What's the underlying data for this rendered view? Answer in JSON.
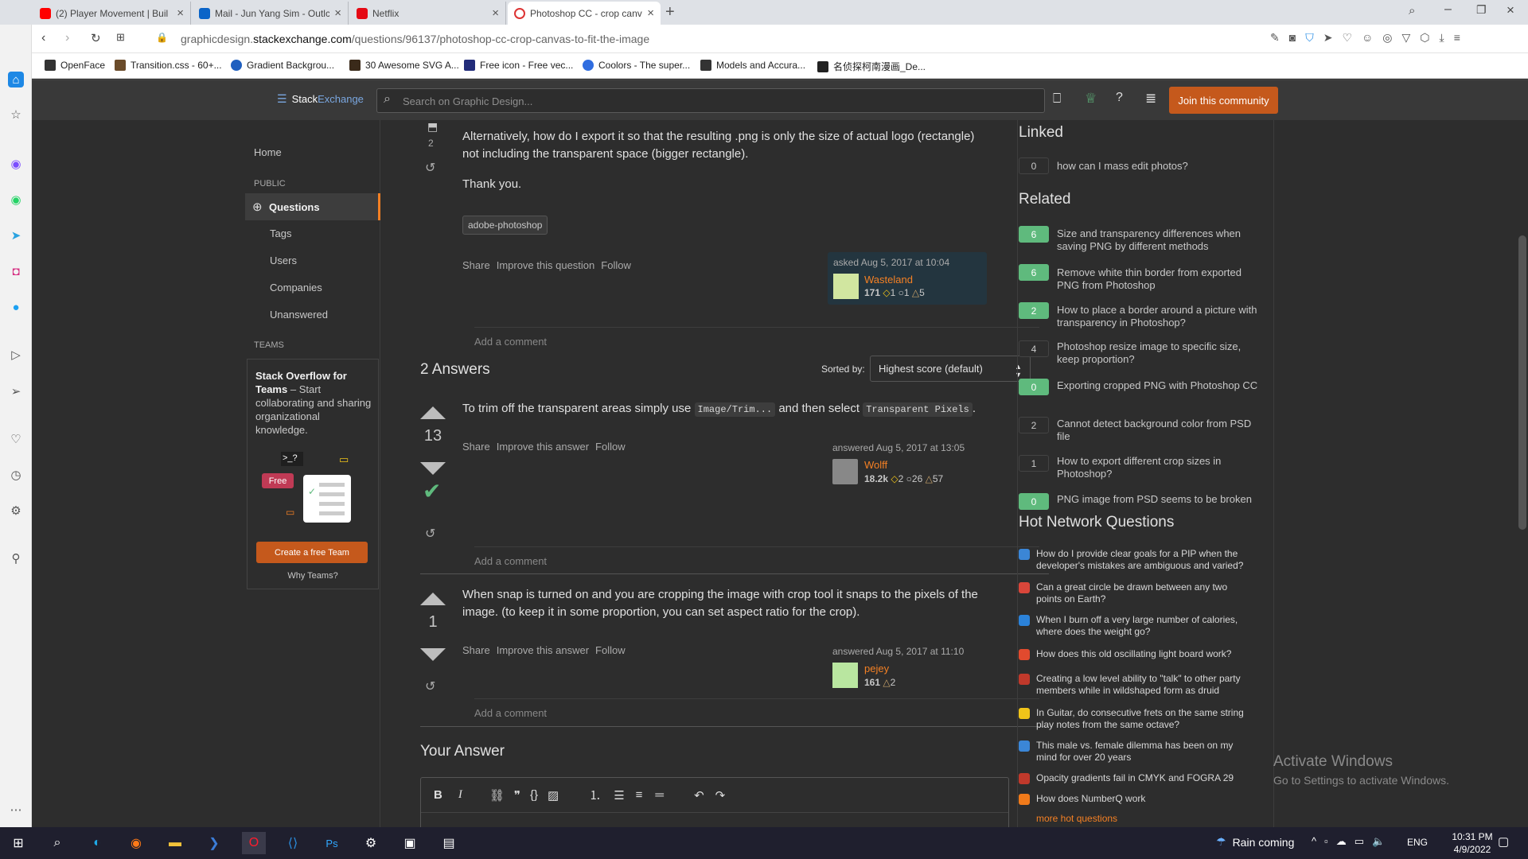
{
  "browser": {
    "tabs": [
      {
        "label": "(2) Player Movement | Buil",
        "color": "#ff0000"
      },
      {
        "label": "Mail - Jun Yang Sim - Outlc",
        "color": "#0a64c8"
      },
      {
        "label": "Netflix",
        "color": "#e50914"
      },
      {
        "label": "Photoshop CC - crop canva",
        "color": "#e0e0e0"
      }
    ],
    "url_prefix": "graphicdesign.",
    "url_domain": "stackexchange.com",
    "url_path": "/questions/96137/photoshop-cc-crop-canvas-to-fit-the-image",
    "bookmarks": [
      {
        "label": "OpenFace",
        "color": "#333"
      },
      {
        "label": "Transition.css - 60+...",
        "color": "#6a4b2a"
      },
      {
        "label": "Gradient Backgrou...",
        "color": "#1f5fbf"
      },
      {
        "label": "30 Awesome SVG A...",
        "color": "#3a2a1a"
      },
      {
        "label": "Free icon - Free vec...",
        "color": "#222c7a"
      },
      {
        "label": "Coolors - The super...",
        "color": "#2f6de0"
      },
      {
        "label": "Models and Accura...",
        "color": "#333"
      },
      {
        "label": "名侦探柯南漫画_De...",
        "color": "#222"
      }
    ]
  },
  "header": {
    "logo_a": "Stack",
    "logo_b": "Exchange",
    "search_placeholder": "Search on Graphic Design...",
    "join": "Join this community"
  },
  "leftnav": {
    "home": "Home",
    "public": "PUBLIC",
    "questions": "Questions",
    "tags": "Tags",
    "users": "Users",
    "companies": "Companies",
    "unanswered": "Unanswered",
    "teams": "TEAMS",
    "teams_title": "Stack Overflow for Teams",
    "teams_desc": " – Start collaborating and sharing organizational knowledge.",
    "free": "Free",
    "prompt": ">_?",
    "create": "Create a free Team",
    "why": "Why Teams?"
  },
  "question": {
    "bookmarks": "2",
    "para1": "Alternatively, how do I export it so that the resulting .png is only the size of actual logo (rectangle) not including the transparent space (bigger rectangle).",
    "para2": "Thank you.",
    "tag": "adobe-photoshop",
    "share": "Share",
    "improve": "Improve this question",
    "follow": "Follow",
    "asked": "asked Aug 5, 2017 at 10:04",
    "user": "Wasteland",
    "rep": "171",
    "gold": "1",
    "silver": "1",
    "bronze": "5",
    "comment": "Add a comment"
  },
  "answers": {
    "count": "2 Answers",
    "sorted": "Sorted by:",
    "sort_value": "Highest score (default)",
    "a1": {
      "score": "13",
      "pre": "To trim off the transparent areas simply use ",
      "code1": "Image/Trim...",
      "mid": " and then select ",
      "code2": "Transparent Pixels",
      "post": ".",
      "share": "Share",
      "improve": "Improve this answer",
      "follow": "Follow",
      "answered": "answered Aug 5, 2017 at 13:05",
      "user": "Wolff",
      "rep": "18.2k",
      "gold": "2",
      "silver": "26",
      "bronze": "57",
      "comment": "Add a comment"
    },
    "a2": {
      "score": "1",
      "text": "When snap is turned on and you are cropping the image with crop tool it snaps to the pixels of the image. (to keep it in some proportion, you can set aspect ratio for the crop).",
      "share": "Share",
      "improve": "Improve this answer",
      "follow": "Follow",
      "answered": "answered Aug 5, 2017 at 11:10",
      "user": "pejey",
      "rep": "161",
      "bronze": "2",
      "comment": "Add a comment"
    },
    "your_answer": "Your Answer"
  },
  "sidebar": {
    "linked_title": "Linked",
    "linked": [
      {
        "score": "0",
        "text": "how can I mass edit photos?"
      }
    ],
    "related_title": "Related",
    "related": [
      {
        "score": "6",
        "text": "Size and transparency differences when saving PNG by different methods"
      },
      {
        "score": "6",
        "text": "Remove white thin border from exported PNG from Photoshop"
      },
      {
        "score": "2",
        "text": "How to place a border around a picture with transparency in Photoshop?"
      },
      {
        "score": "4",
        "text": "Photoshop resize image to specific size, keep proportion?"
      },
      {
        "score": "0",
        "text": "Exporting cropped PNG with Photoshop CC"
      },
      {
        "score": "2",
        "text": "Cannot detect background color from PSD file"
      },
      {
        "score": "1",
        "text": "How to export different crop sizes in Photoshop?"
      },
      {
        "score": "0",
        "text": "PNG image from PSD seems to be broken"
      }
    ],
    "hot_title": "Hot Network Questions",
    "hot": [
      {
        "text": "How do I provide clear goals for a PIP when the developer's mistakes are ambiguous and varied?",
        "color": "#3b86d6"
      },
      {
        "text": "Can a great circle be drawn between any two points on Earth?",
        "color": "#d9463a"
      },
      {
        "text": "When I burn off a very large number of calories, where does the weight go?",
        "color": "#2b82d9"
      },
      {
        "text": "How does this old oscillating light board work?",
        "color": "#e14a2e"
      },
      {
        "text": "Creating a low level ability to \"talk\" to other party members while in wildshaped form as druid",
        "color": "#c0392b"
      },
      {
        "text": "In Guitar, do consecutive frets on the same string play notes from the same octave?",
        "color": "#f0c419"
      },
      {
        "text": "This male vs. female dilemma has been on my mind for over 20 years",
        "color": "#3b86d6"
      },
      {
        "text": "Opacity gradients fail in CMYK and FOGRA 29",
        "color": "#c0392b"
      },
      {
        "text": "How does NumberQ work",
        "color": "#f07a1a"
      }
    ],
    "more": "more hot questions"
  },
  "watermark": {
    "title": "Activate Windows",
    "sub": "Go to Settings to activate Windows."
  },
  "taskbar": {
    "weather": "Rain coming",
    "lang": "ENG",
    "time": "10:31 PM",
    "date": "4/9/2022"
  }
}
